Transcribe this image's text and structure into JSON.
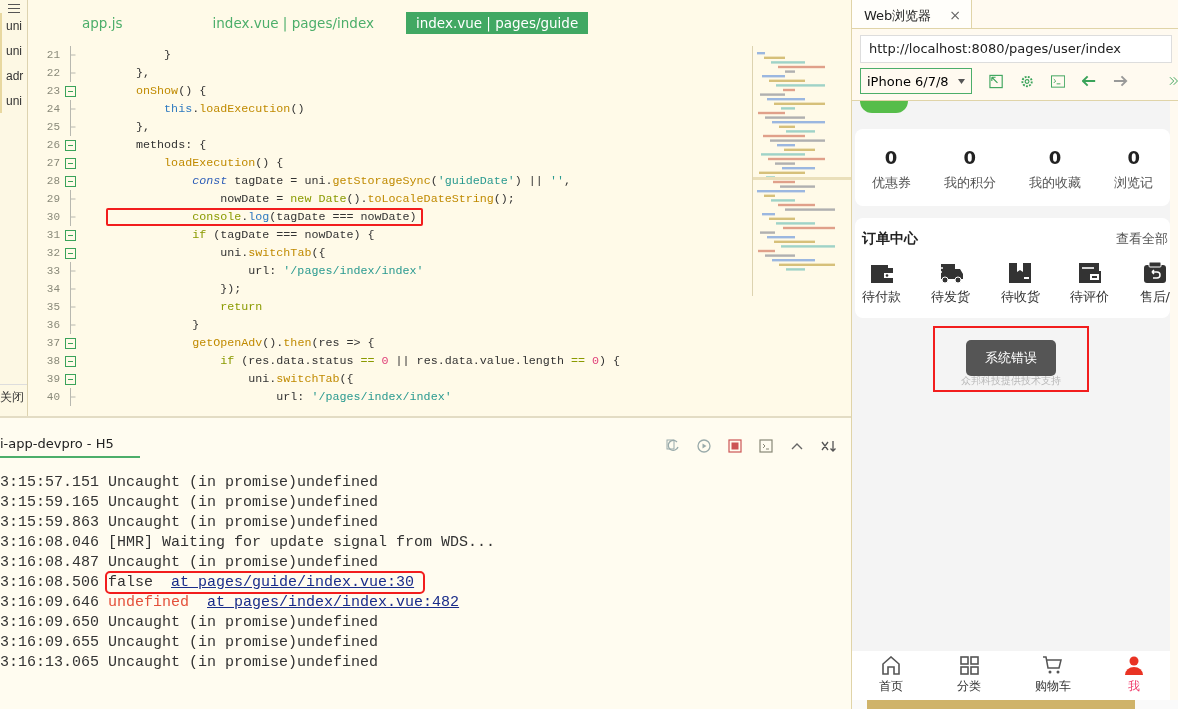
{
  "sidebar": {
    "items": [
      "uni",
      "uni",
      "adr",
      "uni"
    ],
    "footer": "关闭"
  },
  "editor": {
    "tabs": [
      {
        "label": "app.js",
        "selected": false
      },
      {
        "label": "index.vue | pages/index",
        "selected": false
      },
      {
        "label": "index.vue | pages/guide",
        "selected": true
      }
    ],
    "lines": [
      {
        "number": "21",
        "fold": false,
        "highlighted": false,
        "tokens": [
          {
            "kind": "plain",
            "text": "        }"
          }
        ]
      },
      {
        "number": "22",
        "fold": false,
        "highlighted": false,
        "tokens": [
          {
            "kind": "plain",
            "text": "    },"
          }
        ]
      },
      {
        "number": "23",
        "fold": true,
        "highlighted": false,
        "tokens": [
          {
            "kind": "func",
            "text": "    onShow"
          },
          {
            "kind": "plain",
            "text": "() {"
          }
        ]
      },
      {
        "number": "24",
        "fold": false,
        "highlighted": false,
        "tokens": [
          {
            "kind": "ref",
            "text": "        this"
          },
          {
            "kind": "plain",
            "text": "."
          },
          {
            "kind": "func",
            "text": "loadExecution"
          },
          {
            "kind": "plain",
            "text": "()"
          }
        ]
      },
      {
        "number": "25",
        "fold": false,
        "highlighted": false,
        "tokens": [
          {
            "kind": "plain",
            "text": "    },"
          }
        ]
      },
      {
        "number": "26",
        "fold": true,
        "highlighted": false,
        "tokens": [
          {
            "kind": "plain",
            "text": "    methods: {"
          }
        ]
      },
      {
        "number": "27",
        "fold": true,
        "highlighted": false,
        "tokens": [
          {
            "kind": "func",
            "text": "        loadExecution"
          },
          {
            "kind": "plain",
            "text": "() {"
          }
        ]
      },
      {
        "number": "28",
        "fold": true,
        "highlighted": false,
        "tokens": [
          {
            "kind": "decl",
            "text": "            const"
          },
          {
            "kind": "plain",
            "text": " tagDate = uni."
          },
          {
            "kind": "func",
            "text": "getStorageSync"
          },
          {
            "kind": "plain",
            "text": "("
          },
          {
            "kind": "string",
            "text": "'guideDate'"
          },
          {
            "kind": "plain",
            "text": ") || "
          },
          {
            "kind": "string",
            "text": "''"
          },
          {
            "kind": "plain",
            "text": ","
          }
        ]
      },
      {
        "number": "29",
        "fold": false,
        "highlighted": false,
        "tokens": [
          {
            "kind": "plain",
            "text": "                nowDate = "
          },
          {
            "kind": "keyword",
            "text": "new Date"
          },
          {
            "kind": "plain",
            "text": "()."
          },
          {
            "kind": "func",
            "text": "toLocaleDateString"
          },
          {
            "kind": "plain",
            "text": "();"
          }
        ]
      },
      {
        "number": "30",
        "fold": false,
        "highlighted": true,
        "tokens": [
          {
            "kind": "keyword",
            "text": "            console"
          },
          {
            "kind": "plain",
            "text": "."
          },
          {
            "kind": "ref",
            "text": "log"
          },
          {
            "kind": "plain",
            "text": "(tagDate === nowDate)"
          }
        ]
      },
      {
        "number": "31",
        "fold": true,
        "highlighted": false,
        "tokens": [
          {
            "kind": "keyword",
            "text": "            if"
          },
          {
            "kind": "plain",
            "text": " (tagDate === nowDate) {"
          }
        ]
      },
      {
        "number": "32",
        "fold": true,
        "highlighted": false,
        "tokens": [
          {
            "kind": "plain",
            "text": "                uni."
          },
          {
            "kind": "func",
            "text": "switchTab"
          },
          {
            "kind": "plain",
            "text": "({"
          }
        ]
      },
      {
        "number": "33",
        "fold": false,
        "highlighted": false,
        "tokens": [
          {
            "kind": "plain",
            "text": "                    url: "
          },
          {
            "kind": "string",
            "text": "'/pages/index/index'"
          }
        ]
      },
      {
        "number": "34",
        "fold": false,
        "highlighted": false,
        "tokens": [
          {
            "kind": "plain",
            "text": "                });"
          }
        ]
      },
      {
        "number": "35",
        "fold": false,
        "highlighted": false,
        "tokens": [
          {
            "kind": "keyword",
            "text": "                return"
          }
        ]
      },
      {
        "number": "36",
        "fold": false,
        "highlighted": false,
        "tokens": [
          {
            "kind": "plain",
            "text": "            }"
          }
        ]
      },
      {
        "number": "37",
        "fold": true,
        "highlighted": false,
        "tokens": [
          {
            "kind": "func",
            "text": "            getOpenAdv"
          },
          {
            "kind": "plain",
            "text": "()."
          },
          {
            "kind": "func",
            "text": "then"
          },
          {
            "kind": "plain",
            "text": "(res => {"
          }
        ]
      },
      {
        "number": "38",
        "fold": true,
        "highlighted": false,
        "tokens": [
          {
            "kind": "keyword",
            "text": "                if"
          },
          {
            "kind": "plain",
            "text": " (res.data.status "
          },
          {
            "kind": "keyword",
            "text": "=="
          },
          {
            "kind": "number",
            "text": " 0"
          },
          {
            "kind": "plain",
            "text": " || res.data.value.length "
          },
          {
            "kind": "keyword",
            "text": "=="
          },
          {
            "kind": "number",
            "text": " 0"
          },
          {
            "kind": "plain",
            "text": ") {"
          }
        ]
      },
      {
        "number": "39",
        "fold": true,
        "highlighted": false,
        "tokens": [
          {
            "kind": "plain",
            "text": "                    uni."
          },
          {
            "kind": "func",
            "text": "switchTab"
          },
          {
            "kind": "plain",
            "text": "({"
          }
        ]
      },
      {
        "number": "40",
        "fold": false,
        "highlighted": false,
        "tokens": [
          {
            "kind": "plain",
            "text": "                        url: "
          },
          {
            "kind": "string",
            "text": "'/pages/index/index'"
          }
        ]
      }
    ]
  },
  "console": {
    "title": "i-app-devpro - H5",
    "entries": [
      {
        "time": "3:15:57.151",
        "message": "Uncaught (in promise)undefined",
        "kind": "log",
        "highlighted": false
      },
      {
        "time": "3:15:59.165",
        "message": "Uncaught (in promise)undefined",
        "kind": "log",
        "highlighted": false
      },
      {
        "time": "3:15:59.863",
        "message": "Uncaught (in promise)undefined",
        "kind": "log",
        "highlighted": false
      },
      {
        "time": "3:16:08.046",
        "message": "[HMR] Waiting for update signal from WDS...",
        "kind": "log",
        "highlighted": false
      },
      {
        "time": "3:16:08.487",
        "message": "Uncaught (in promise)undefined",
        "kind": "log",
        "highlighted": false
      },
      {
        "time": "3:16:08.506",
        "message": "false",
        "link": "at pages/guide/index.vue:30",
        "kind": "log",
        "highlighted": true
      },
      {
        "time": "3:16:09.646",
        "message": "undefined",
        "link": "at pages/index/index.vue:482",
        "kind": "error",
        "highlighted": false
      },
      {
        "time": "3:16:09.650",
        "message": "Uncaught (in promise)undefined",
        "kind": "log",
        "highlighted": false
      },
      {
        "time": "3:16:09.655",
        "message": "Uncaught (in promise)undefined",
        "kind": "log",
        "highlighted": false
      },
      {
        "time": "3:16:13.065",
        "message": "Uncaught (in promise)undefined",
        "kind": "log",
        "highlighted": false
      }
    ]
  },
  "browser": {
    "tab": {
      "label": "Web浏览器",
      "close": "×"
    },
    "url": "http://localhost:8080/pages/user/index",
    "device": "iPhone 6/7/8",
    "stats": [
      {
        "value": "0",
        "label": "优惠券"
      },
      {
        "value": "0",
        "label": "我的积分"
      },
      {
        "value": "0",
        "label": "我的收藏"
      },
      {
        "value": "0",
        "label": "浏览记"
      }
    ],
    "orders": {
      "title": "订单中心",
      "more": "查看全部",
      "items": [
        {
          "label": "待付款",
          "kind": "wallet"
        },
        {
          "label": "待发货",
          "kind": "truck"
        },
        {
          "label": "待收货",
          "kind": "box"
        },
        {
          "label": "待评价",
          "kind": "card"
        },
        {
          "label": "售后/",
          "kind": "return"
        }
      ]
    },
    "toast": {
      "message": "系统错误",
      "highlighted": true
    },
    "footer_note": "众邦科技提供技术支持",
    "tabbar": [
      {
        "label": "首页",
        "kind": "home",
        "selected": false
      },
      {
        "label": "分类",
        "kind": "grid",
        "selected": false
      },
      {
        "label": "购物车",
        "kind": "cart",
        "selected": false
      },
      {
        "label": "我",
        "kind": "user",
        "selected": true
      }
    ]
  }
}
